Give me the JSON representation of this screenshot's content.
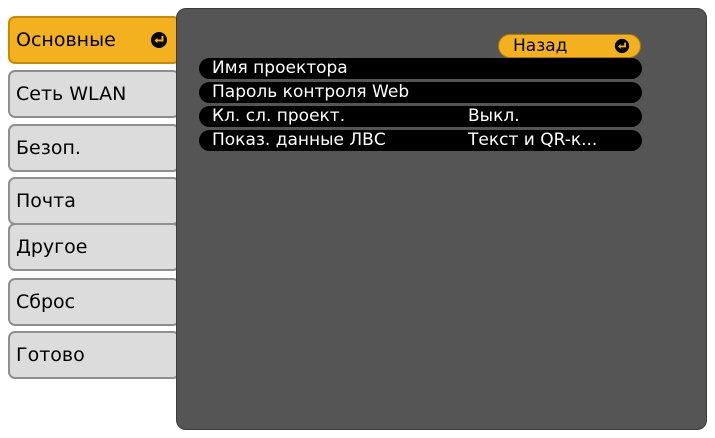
{
  "sidebar": {
    "items": [
      {
        "label": "Основные",
        "selected": true
      },
      {
        "label": "Сеть WLAN",
        "selected": false
      },
      {
        "label": "Безоп.",
        "selected": false
      },
      {
        "label": "Почта",
        "selected": false
      },
      {
        "label": "Другое",
        "selected": false
      },
      {
        "label": "Сброс",
        "selected": false
      },
      {
        "label": "Готово",
        "selected": false
      }
    ]
  },
  "panel": {
    "back_label": "Назад",
    "rows": [
      {
        "label": "Имя проектора",
        "value": ""
      },
      {
        "label": "Пароль контроля Web",
        "value": ""
      },
      {
        "label": "Кл. сл. проект.",
        "value": "Выкл."
      },
      {
        "label": "Показ. данные ЛВС",
        "value": "Текст и QR-к..."
      }
    ]
  },
  "icons": {
    "enter": "enter-icon"
  },
  "colors": {
    "accent": "#f3b11f",
    "panel_background": "#555555",
    "tab_background": "#dcdcdc",
    "row_background": "#000000"
  }
}
